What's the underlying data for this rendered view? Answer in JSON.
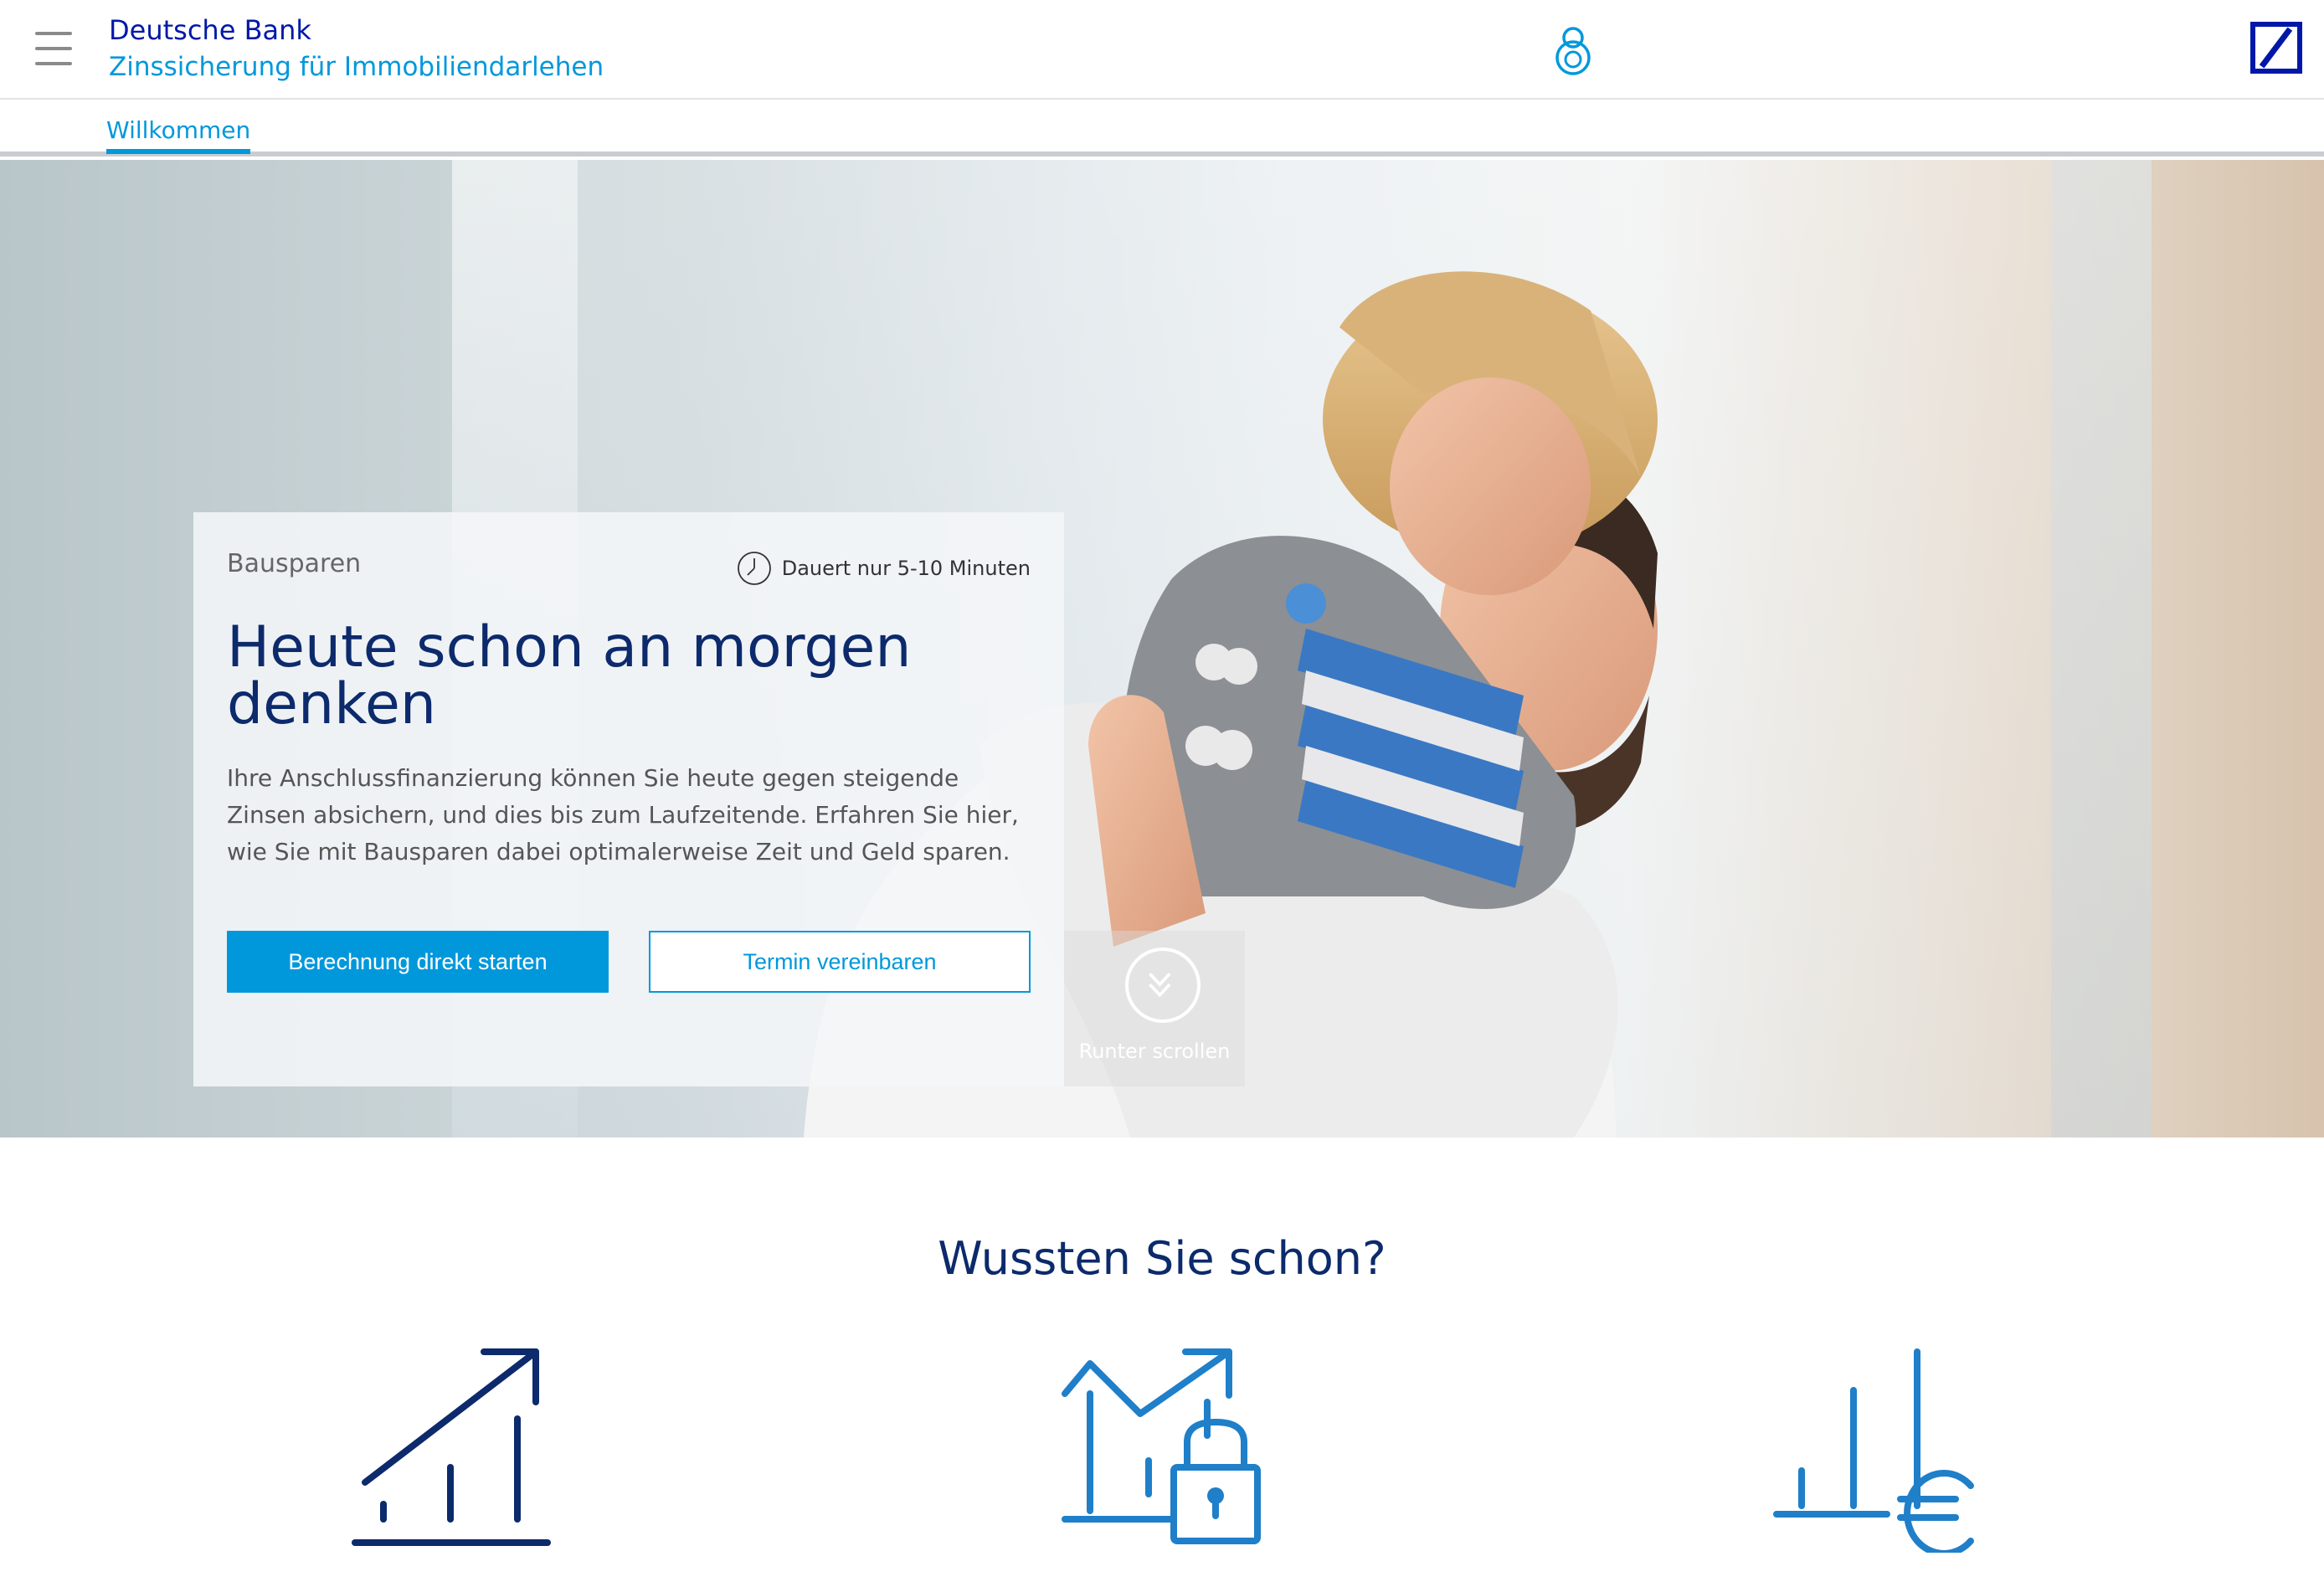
{
  "header": {
    "brand_name": "Deutsche Bank",
    "brand_subtitle": "Zinssicherung für Immobiliendarlehen",
    "menu_icon": "hamburger-menu-icon",
    "user_icon": "user-icon",
    "logo": "deutsche-bank-logo"
  },
  "tabs": [
    {
      "label": "Willkommen",
      "active": true
    }
  ],
  "hero": {
    "card": {
      "label": "Bausparen",
      "duration": "Dauert nur 5-10 Minuten",
      "title": "Heute schon an morgen denken",
      "text": "Ihre Anschlussfinanzierung können Sie heute gegen steigende Zinsen absichern, und dies bis zum Laufzeitende. Erfahren Sie hier, wie Sie mit Bausparen dabei optimalerweise Zeit und Geld sparen.",
      "primary_button": "Berechnung direkt starten",
      "secondary_button": "Termin vereinbaren"
    },
    "scroll_label": "Runter scrollen"
  },
  "section": {
    "title": "Wussten Sie schon?",
    "icons": [
      "growth-chart-icon",
      "chart-lock-icon",
      "chart-euro-icon"
    ]
  },
  "colors": {
    "brand_blue": "#0018a8",
    "accent_blue": "#0098db",
    "heading_navy": "#0c2a6c",
    "icon_blue": "#1f7fc9"
  }
}
